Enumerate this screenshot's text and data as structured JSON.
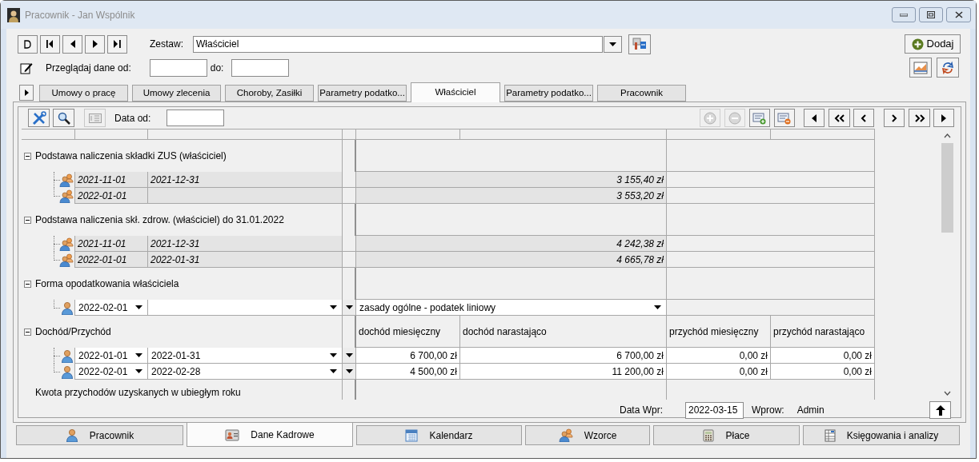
{
  "window": {
    "title": "Pracownik - Jan Wspólnik"
  },
  "set": {
    "label": "Zestaw:",
    "value": "Właściciel"
  },
  "filter": {
    "label": "Przeglądaj dane od:",
    "to_label": "do:"
  },
  "add_button": "Dodaj",
  "tabs": [
    {
      "label": "Umowy o pracę",
      "selected": false
    },
    {
      "label": "Umowy zlecenia",
      "selected": false
    },
    {
      "label": "Choroby, Zasiłki",
      "selected": false
    },
    {
      "label": "Parametry podatko...",
      "selected": false
    },
    {
      "label": "Właściciel",
      "selected": true
    },
    {
      "label": "Parametry podatko...",
      "selected": false
    },
    {
      "label": "Pracownik",
      "selected": false
    }
  ],
  "toolbar": {
    "date_label": "Data od:"
  },
  "grid": {
    "groups": [
      {
        "label": "Podstawa naliczenia składki ZUS (właściciel)",
        "expanded": true,
        "rows": [
          {
            "kind": "readonly",
            "date_from": "2021-11-01",
            "date_to": "2021-12-31",
            "amount": "3 155,40 zł"
          },
          {
            "kind": "readonly",
            "date_from": "2022-01-01",
            "amount": "3 553,20 zł"
          }
        ]
      },
      {
        "label": "Podstawa naliczenia skł. zdrow. (właściciel) do 31.01.2022",
        "expanded": true,
        "rows": [
          {
            "kind": "readonly",
            "date_from": "2021-11-01",
            "date_to": "2021-12-31",
            "amount": "4 242,38 zł"
          },
          {
            "kind": "readonly",
            "date_from": "2022-01-01",
            "date_to": "2022-01-31",
            "amount": "4 665,78 zł"
          }
        ]
      },
      {
        "label": "Forma opodatkowania właściciela",
        "expanded": true,
        "rows": [
          {
            "kind": "choice",
            "date_from": "2022-02-01",
            "value": "zasady ogólne - podatek liniowy"
          }
        ]
      },
      {
        "label": "Dochód/Przychód",
        "expanded": true,
        "columns": [
          "dochód miesięczny",
          "dochód narastająco",
          "przychód miesięczny",
          "przychód narastająco"
        ],
        "rows": [
          {
            "kind": "amounts",
            "date_from": "2022-01-01",
            "date_to": "2022-01-31",
            "values": [
              "6 700,00 zł",
              "6 700,00 zł",
              "0,00 zł",
              "0,00 zł"
            ]
          },
          {
            "kind": "amounts",
            "date_from": "2022-02-01",
            "date_to": "2022-02-28",
            "values": [
              "4 500,00 zł",
              "11 200,00 zł",
              "0,00 zł",
              "0,00 zł"
            ]
          }
        ]
      },
      {
        "label": "Kwota przychodów uzyskanych w ubiegłym roku"
      }
    ]
  },
  "footer": {
    "date_label": "Data Wpr:",
    "date_value": "2022-03-15",
    "author_label": "Wprow:",
    "author": "Admin"
  },
  "bottom_tabs": [
    {
      "label": "Pracownik",
      "selected": false
    },
    {
      "label": "Dane Kadrowe",
      "selected": true
    },
    {
      "label": "Kalendarz",
      "selected": false
    },
    {
      "label": "Wzorce",
      "selected": false
    },
    {
      "label": "Płace",
      "selected": false
    },
    {
      "label": "Księgowania i analizy",
      "selected": false
    }
  ]
}
